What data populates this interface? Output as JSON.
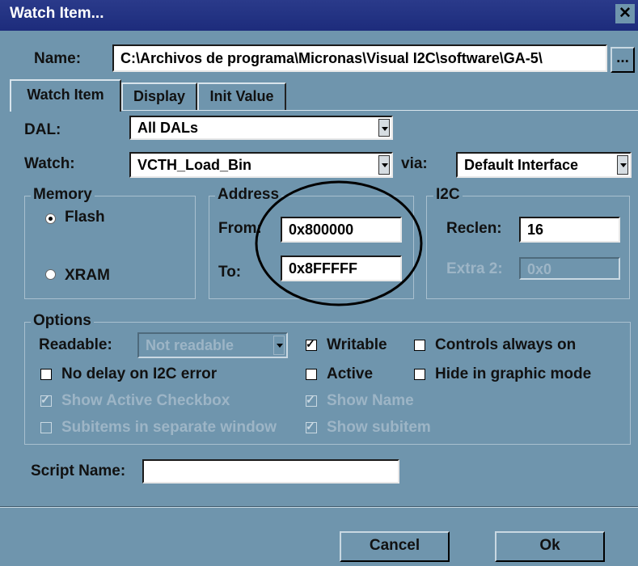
{
  "window": {
    "title": "Watch Item...",
    "close_glyph": "✕"
  },
  "name": {
    "label": "Name:",
    "value": "C:\\Archivos de programa\\Micronas\\Visual I2C\\software\\GA-5\\",
    "browse_label": "..."
  },
  "tabs": [
    {
      "label": "Watch Item",
      "active": true
    },
    {
      "label": "Display",
      "active": false
    },
    {
      "label": "Init Value",
      "active": false
    }
  ],
  "dal": {
    "label": "DAL:",
    "value": "All DALs"
  },
  "watch": {
    "label": "Watch:",
    "value": "VCTH_Load_Bin",
    "via_label": "via:",
    "via_value": "Default Interface"
  },
  "memory": {
    "title": "Memory",
    "flash_label": "Flash",
    "xram_label": "XRAM",
    "selected": "Flash"
  },
  "address": {
    "title": "Address",
    "from_label": "From:",
    "from_value": "0x800000",
    "to_label": "To:",
    "to_value": "0x8FFFFF"
  },
  "i2c": {
    "title": "I2C",
    "reclen_label": "Reclen:",
    "reclen_value": "16",
    "extra2_label": "Extra 2:",
    "extra2_value": "0x0"
  },
  "options": {
    "title": "Options",
    "readable_label": "Readable:",
    "readable_value": "Not readable",
    "checkboxes": {
      "writable": {
        "label": "Writable",
        "checked": true,
        "enabled": true
      },
      "controls_always_on": {
        "label": "Controls always on",
        "checked": false,
        "enabled": true
      },
      "no_delay": {
        "label": "No delay on I2C error",
        "checked": false,
        "enabled": true
      },
      "active": {
        "label": "Active",
        "checked": false,
        "enabled": true
      },
      "hide_graphic": {
        "label": "Hide in graphic mode",
        "checked": false,
        "enabled": true
      },
      "show_active_checkbox": {
        "label": "Show Active Checkbox",
        "checked": true,
        "enabled": false
      },
      "show_name": {
        "label": "Show Name",
        "checked": true,
        "enabled": false
      },
      "subitems_separate": {
        "label": "Subitems in separate window",
        "checked": false,
        "enabled": false
      },
      "show_subitem": {
        "label": "Show subitem",
        "checked": true,
        "enabled": false
      }
    }
  },
  "script": {
    "label": "Script Name:",
    "value": ""
  },
  "buttons": {
    "cancel": "Cancel",
    "ok": "Ok"
  },
  "colors": {
    "dialog_bg": "#6f95ad",
    "titlebar": "#1d2c7c",
    "disabled_text": "#9db5c6"
  }
}
